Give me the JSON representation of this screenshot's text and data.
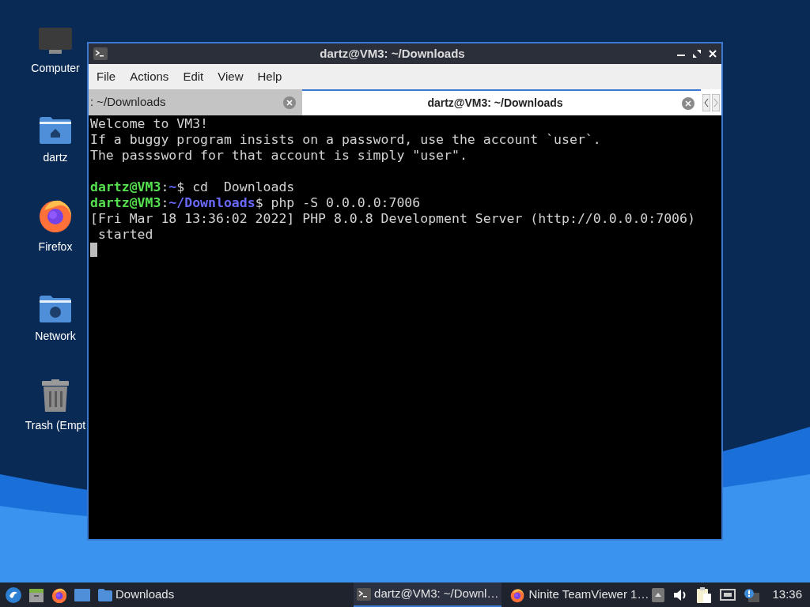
{
  "desktop_icons": [
    {
      "label": "Computer",
      "kind": "computer"
    },
    {
      "label": "dartz",
      "kind": "home"
    },
    {
      "label": "Firefox",
      "kind": "firefox"
    },
    {
      "label": "Network",
      "kind": "network"
    },
    {
      "label": "Trash (Empt",
      "kind": "trash"
    }
  ],
  "window": {
    "title": "dartz@VM3: ~/Downloads",
    "menu": [
      "File",
      "Actions",
      "Edit",
      "View",
      "Help"
    ],
    "tabs": [
      {
        "label": ": ~/Downloads",
        "selected": false
      },
      {
        "label": "dartz@VM3: ~/Downloads",
        "selected": true
      }
    ]
  },
  "terminal": {
    "lines": [
      {
        "kind": "text",
        "segments": [
          {
            "kind": "plain",
            "text": "Welcome to VM3!"
          }
        ]
      },
      {
        "kind": "text",
        "segments": [
          {
            "kind": "plain",
            "text": "If a buggy program insists on a password, use the account `user`."
          }
        ]
      },
      {
        "kind": "text",
        "segments": [
          {
            "kind": "plain",
            "text": "The passsword for that account is simply \"user\"."
          }
        ]
      },
      {
        "kind": "blank"
      },
      {
        "kind": "text",
        "segments": [
          {
            "kind": "user",
            "text": "dartz@VM3"
          },
          {
            "kind": "plain",
            "text": ":"
          },
          {
            "kind": "path",
            "text": "~"
          },
          {
            "kind": "plain",
            "text": "$ cd  Downloads"
          }
        ]
      },
      {
        "kind": "text",
        "segments": [
          {
            "kind": "user",
            "text": "dartz@VM3"
          },
          {
            "kind": "plain",
            "text": ":"
          },
          {
            "kind": "path",
            "text": "~/Downloads"
          },
          {
            "kind": "plain",
            "text": "$ php -S 0.0.0.0:7006"
          }
        ]
      },
      {
        "kind": "text",
        "segments": [
          {
            "kind": "plain",
            "text": "[Fri Mar 18 13:36:02 2022] PHP 8.0.8 Development Server (http://0.0.0.0:7006)"
          }
        ]
      },
      {
        "kind": "text",
        "segments": [
          {
            "kind": "plain",
            "text": " started"
          }
        ]
      }
    ]
  },
  "taskbar": {
    "launchers": [
      {
        "kind": "start"
      },
      {
        "kind": "files"
      },
      {
        "kind": "firefox"
      },
      {
        "kind": "desktop"
      }
    ],
    "tasks": [
      {
        "label": "Downloads",
        "kind": "folder",
        "selected": false
      },
      {
        "label": "dartz@VM3: ~/Downl…",
        "kind": "terminal",
        "selected": true
      },
      {
        "label": "Ninite TeamViewer 1…",
        "kind": "firefox",
        "selected": false
      }
    ],
    "tray": [
      {
        "kind": "up"
      },
      {
        "kind": "volume"
      },
      {
        "kind": "clipboard"
      },
      {
        "kind": "network"
      },
      {
        "kind": "notification"
      }
    ],
    "clock": "13:36"
  }
}
